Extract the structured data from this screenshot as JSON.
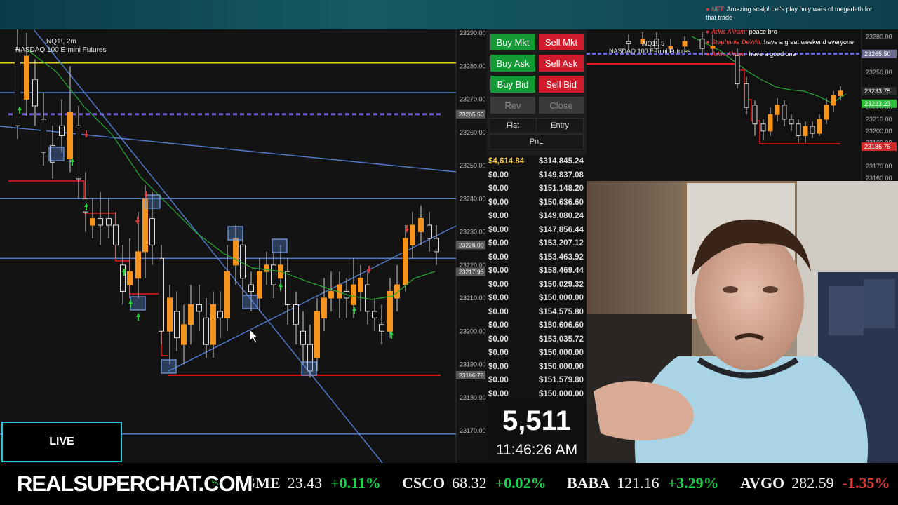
{
  "main_chart": {
    "symbol": "NQ1!, 2m",
    "name": "NASDAQ 100 E-mini Futures",
    "price_axis": [
      "23290.00",
      "23280.00",
      "23270.00",
      "23260.00",
      "23250.00",
      "23240.00",
      "23230.00",
      "23220.00",
      "23210.00",
      "23200.00",
      "23190.00",
      "23180.00",
      "23170.00"
    ],
    "price_tags": [
      {
        "label": "23265.50",
        "value": 23265.5,
        "color": "#5a5a5a"
      },
      {
        "label": "23226.00",
        "value": 23226.0,
        "color": "#5a5a5a"
      },
      {
        "label": "23217.95",
        "value": 23217.95,
        "color": "#5a5a5a"
      },
      {
        "label": "23186.75",
        "value": 23186.75,
        "color": "#5a5a5a"
      }
    ]
  },
  "order_panel": {
    "buy_mkt": "Buy Mkt",
    "sell_mkt": "Sell Mkt",
    "buy_ask": "Buy Ask",
    "sell_ask": "Sell Ask",
    "buy_bid": "Buy Bid",
    "sell_bid": "Sell Bid",
    "rev": "Rev",
    "close": "Close",
    "flat": "Flat",
    "entry": "Entry",
    "pnl": "PnL"
  },
  "pnl_rows": [
    {
      "left": "$4,614.84",
      "right": "$314,845.24"
    },
    {
      "left": "$0.00",
      "right": "$149,837.08"
    },
    {
      "left": "$0.00",
      "right": "$151,148.20"
    },
    {
      "left": "$0.00",
      "right": "$150,636.60"
    },
    {
      "left": "$0.00",
      "right": "$149,080.24"
    },
    {
      "left": "$0.00",
      "right": "$147,856.44"
    },
    {
      "left": "$0.00",
      "right": "$153,207.12"
    },
    {
      "left": "$0.00",
      "right": "$153,463.92"
    },
    {
      "left": "$0.00",
      "right": "$158,469.44"
    },
    {
      "left": "$0.00",
      "right": "$150,029.32"
    },
    {
      "left": "$0.00",
      "right": "$150,000.00"
    },
    {
      "left": "$0.00",
      "right": "$154,575.80"
    },
    {
      "left": "$0.00",
      "right": "$150,606.60"
    },
    {
      "left": "$0.00",
      "right": "$153,035.72"
    },
    {
      "left": "$0.00",
      "right": "$150,000.00"
    },
    {
      "left": "$0.00",
      "right": "$150,000.00"
    },
    {
      "left": "$0.00",
      "right": "$151,579.80"
    },
    {
      "left": "$0.00",
      "right": "$150,000.00"
    }
  ],
  "counter": {
    "value": "5,511",
    "time": "11:46:26 AM"
  },
  "mini_chart": {
    "symbol": "NQ1!, 5",
    "name": "NASDAQ 100 E-mini Futures",
    "price_axis": [
      "23280.00",
      "23250.00",
      "23220.00",
      "23210.00",
      "23200.00",
      "23190.00",
      "23170.00",
      "23160.00"
    ],
    "tags": [
      {
        "label": "23265.50",
        "bg": "#6a6a8c"
      },
      {
        "label": "23233.75",
        "bg": "#2b2b2b"
      },
      {
        "label": "23223.23",
        "bg": "#2fbf3c"
      },
      {
        "label": "23186.75",
        "bg": "#cf2a2a"
      }
    ]
  },
  "chat": [
    {
      "name": "NFT:",
      "text": "Amazing scalp! Let's play holy wars of megadeth for"
    },
    {
      "name": "",
      "text": "that trade"
    },
    {
      "name": "Adris Akram:",
      "text": "peace bro"
    },
    {
      "name": "Stephanie DeWitt:",
      "text": "have a great weekend everyone"
    },
    {
      "name": "Adris Akram:",
      "text": "have a good one"
    }
  ],
  "live_label": "LIVE",
  "ticker": {
    "brand": "REALSUPERCHAT.COM",
    "partial": "%",
    "items": [
      {
        "sym": "GME",
        "price": "23.43",
        "chg": "+0.11%",
        "dir": "up"
      },
      {
        "sym": "CSCO",
        "price": "68.32",
        "chg": "+0.02%",
        "dir": "up"
      },
      {
        "sym": "BABA",
        "price": "121.16",
        "chg": "+3.29%",
        "dir": "up"
      },
      {
        "sym": "AVGO",
        "price": "282.59",
        "chg": "-1.35%",
        "dir": "dn"
      }
    ]
  },
  "colors": {
    "buy": "#159b35",
    "sell": "#d01b2d",
    "up_candle": "#f7941d",
    "down_candle": "#ffffff",
    "hline": "#4f79c9",
    "red_line": "#e11b1b",
    "yellow_line": "#e2d21a",
    "ema": "#2aa836"
  }
}
